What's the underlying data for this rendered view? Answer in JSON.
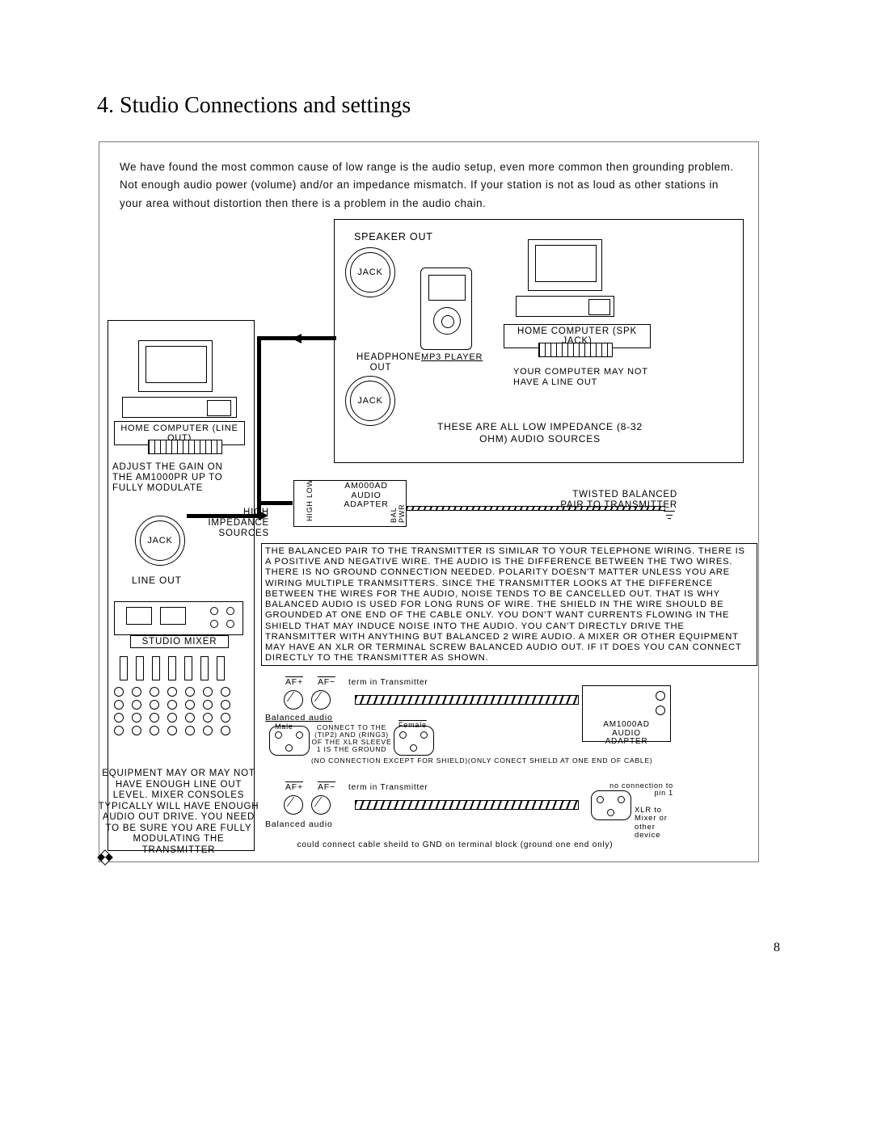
{
  "page": {
    "heading": "4. Studio Connections and settings",
    "number": "8"
  },
  "intro": "We have found the most common cause of low range is the audio setup, even more common then grounding problem. Not enough audio power (volume) and/or an impedance mismatch. If your station is not as loud as other stations in your area without distortion then there is a problem in the audio chain.",
  "sources": {
    "speaker_out": "SPEAKER OUT",
    "jack": "JACK",
    "mp3": "MP3 PLAYER",
    "headphone_out": "HEADPHONE OUT",
    "right_computer": "HOME COMPUTER (SPK JACK)",
    "right_note": "YOUR COMPUTER MAY NOT HAVE A LINE OUT",
    "box_note": "THESE ARE ALL LOW IMPEDANCE (8-32 OHM) AUDIO SOURCES"
  },
  "left": {
    "computer": "HOME COMPUTER (LINE OUT)",
    "gain": "ADJUST THE GAIN ON THE AM1000PR UP TO FULLY MODULATE",
    "hi_imp": "HIGH IMPEDANCE SOURCES",
    "line_out": "LINE OUT",
    "mixer": "STUDIO MIXER",
    "mix_note": "EQUIPMENT MAY OR MAY NOT HAVE ENOUGH LINE OUT LEVEL. MIXER CONSOLES TYPICALLY WILL HAVE ENOUGH AUDIO OUT DRIVE. YOU NEED TO BE SURE YOU ARE FULLY MODULATING THE TRANSMITTER"
  },
  "adapter": {
    "label": "AM000AD AUDIO ADAPTER",
    "hl": "HIGH  LOW",
    "bp": "BAL PWR",
    "twisted": "TWISTED BALANCED PAIR TO TRANSMITTER"
  },
  "balanced_text": "THE BALANCED PAIR TO THE TRANSMITTER IS SIMILAR TO YOUR TELEPHONE WIRING. THERE IS A POSITIVE AND NEGATIVE WIRE. THE AUDIO IS THE DIFFERENCE BETWEEN THE TWO WIRES. THERE IS NO GROUND CONNECTION NEEDED. POLARITY DOESN'T MATTER UNLESS YOU ARE WIRING MULTIPLE TRANMSITTERS. SINCE THE TRANSMITTER LOOKS AT THE DIFFERENCE BETWEEN THE WIRES FOR THE AUDIO, NOISE TENDS TO BE CANCELLED OUT. THAT IS WHY BALANCED AUDIO IS USED FOR LONG RUNS OF WIRE. THE SHIELD IN THE WIRE SHOULD BE GROUNDED AT ONE END OF THE CABLE ONLY. YOU DON'T WANT CURRENTS FLOWING IN THE SHIELD THAT MAY INDUCE NOISE INTO THE AUDIO. YOU CAN'T DIRECTLY DRIVE THE TRANSMITTER WITH ANYTHING BUT BALANCED 2 WIRE AUDIO. A MIXER OR OTHER EQUIPMENT MAY HAVE AN XLR OR TERMINAL SCREW BALANCED AUDIO OUT. IF IT DOES YOU CAN CONNECT DIRECTLY TO THE TRANSMITTER AS SHOWN.",
  "wiring": {
    "af_plus": "AF+",
    "af_minus": "AF−",
    "term": "term in Transmitter",
    "bal_audio": "Balanced audio",
    "male": "Male",
    "female": "Female",
    "connect": "CONNECT TO THE (TIP2) AND (RING3) OF THE XLR SLEEVE 1 IS THE GROUND",
    "shield": "(NO CONNECTION EXCEPT FOR SHIELD)(ONLY CONECT SHIELD AT ONE END OF CABLE)",
    "adapter2": "AM1000AD AUDIO ADAPTER",
    "no_conn": "no connection to pin 1",
    "xlr_to": "XLR to Mixer or other device",
    "foot": "could connect cable sheild to GND on terminal block (ground one end only)"
  }
}
